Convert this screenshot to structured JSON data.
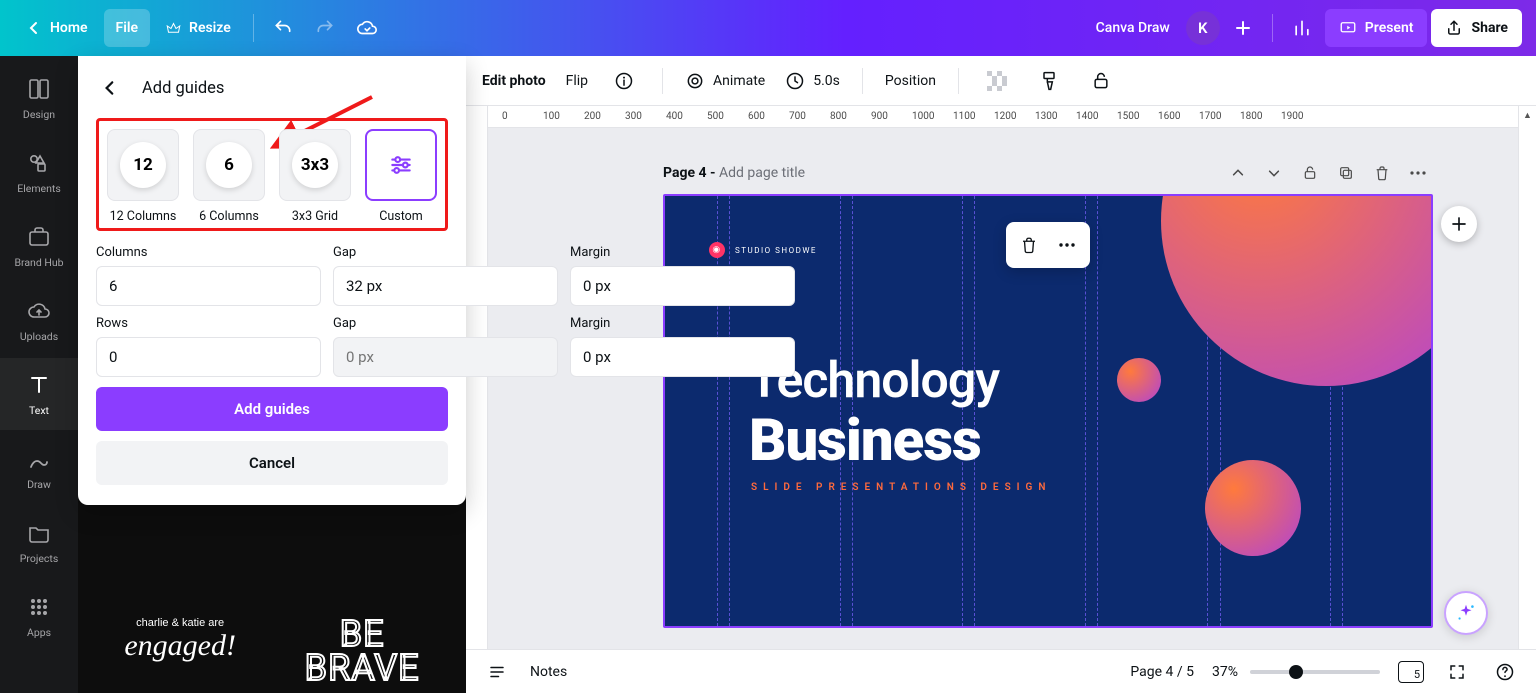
{
  "topbar": {
    "home": "Home",
    "file": "File",
    "resize": "Resize",
    "doc_name": "Canva Draw",
    "avatar": "K",
    "present": "Present",
    "share": "Share"
  },
  "sidebar": [
    {
      "label": "Design"
    },
    {
      "label": "Elements"
    },
    {
      "label": "Brand Hub"
    },
    {
      "label": "Uploads"
    },
    {
      "label": "Text"
    },
    {
      "label": "Draw"
    },
    {
      "label": "Projects"
    },
    {
      "label": "Apps"
    }
  ],
  "popover": {
    "title": "Add guides",
    "presets": [
      {
        "badge": "12",
        "label": "12 Columns"
      },
      {
        "badge": "6",
        "label": "6 Columns"
      },
      {
        "badge": "3x3",
        "label": "3x3 Grid"
      },
      {
        "badge": "custom",
        "label": "Custom"
      }
    ],
    "labels": {
      "columns": "Columns",
      "gap": "Gap",
      "margin": "Margin",
      "rows": "Rows"
    },
    "values": {
      "columns": "6",
      "col_gap": "32 px",
      "col_margin": "0 px",
      "rows": "0",
      "row_gap_placeholder": "0 px",
      "row_margin": "0 px"
    },
    "add": "Add guides",
    "cancel": "Cancel"
  },
  "thumbs": {
    "engaged_line1": "charlie & katie are",
    "engaged_line2": "engaged!",
    "brave_line1": "BE",
    "brave_line2": "BRAVE"
  },
  "context": {
    "edit_photo": "Edit photo",
    "flip": "Flip",
    "animate": "Animate",
    "timing": "5.0s",
    "position": "Position"
  },
  "ruler_h": [
    "0",
    "100",
    "200",
    "300",
    "400",
    "500",
    "600",
    "700",
    "800",
    "900",
    "1000",
    "1100",
    "1200",
    "1300",
    "1400",
    "1500",
    "1600",
    "1700",
    "1800",
    "1900"
  ],
  "page_header": {
    "page": "Page 4 - ",
    "placeholder": "Add page title"
  },
  "slide": {
    "brand": "STUDIO SHODWE",
    "title1": "Technology",
    "title2": "Business",
    "sub": "SLIDE PRESENTATIONS DESIGN"
  },
  "footer": {
    "notes": "Notes",
    "page_ind": "Page 4 / 5",
    "zoom": "37%",
    "grid_badge": "5"
  }
}
